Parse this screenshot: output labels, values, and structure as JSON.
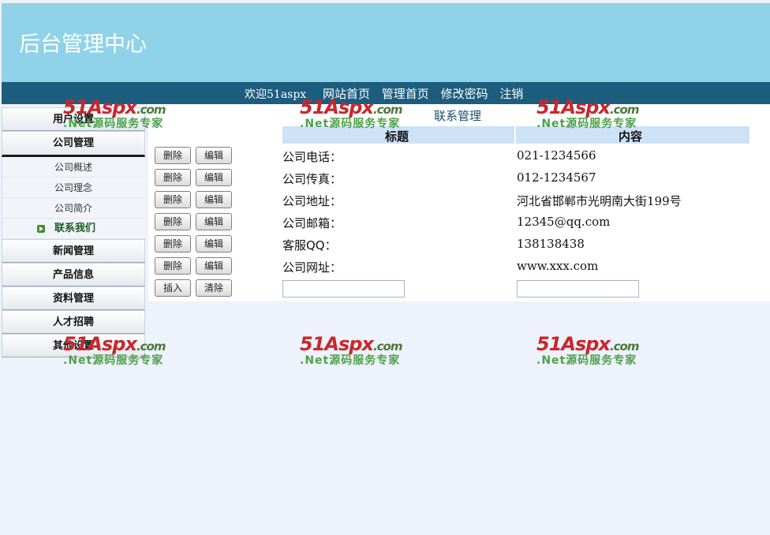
{
  "header": {
    "title": "后台管理中心"
  },
  "nav": {
    "welcome": "欢迎51aspx",
    "links": [
      "网站首页",
      "管理首页",
      "修改密码",
      "注销"
    ]
  },
  "sidebar": {
    "menus": [
      {
        "label": "用户设置"
      },
      {
        "label": "公司管理",
        "active": true,
        "sub": [
          "公司概述",
          "公司理念",
          "公司简介",
          "联系我们"
        ],
        "current": "联系我们"
      },
      {
        "label": "新闻管理"
      },
      {
        "label": "产品信息"
      },
      {
        "label": "资料管理"
      },
      {
        "label": "人才招聘"
      },
      {
        "label": "其他设置"
      }
    ]
  },
  "content": {
    "title": "联系管理",
    "col_title": "标题",
    "col_content": "内容",
    "delete_label": "删除",
    "edit_label": "编辑",
    "insert_label": "插入",
    "clear_label": "清除",
    "rows": [
      {
        "title": "公司电话：",
        "content": "021-1234566"
      },
      {
        "title": "公司传真：",
        "content": "012-1234567"
      },
      {
        "title": "公司地址：",
        "content": "河北省邯郸市光明南大街199号"
      },
      {
        "title": "公司邮箱：",
        "content": "12345@qq.com"
      },
      {
        "title": "客服QQ：",
        "content": "138138438"
      },
      {
        "title": "公司网址：",
        "content": "www.xxx.com"
      }
    ]
  },
  "watermark": {
    "logo_num": "51",
    "logo_aspx": "Aspx",
    "logo_com": ".com",
    "slogan": ".Net源码服务专家"
  }
}
